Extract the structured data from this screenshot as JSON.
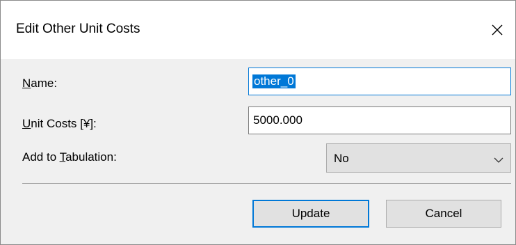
{
  "window": {
    "title": "Edit Other Unit Costs"
  },
  "form": {
    "name": {
      "label_mnemonic": "N",
      "label_rest": "ame:",
      "value": "other_0"
    },
    "unit_costs": {
      "label_mnemonic": "U",
      "label_rest": "nit Costs [¥]:",
      "value": "5000.000"
    },
    "tabulation": {
      "label_prefix": "Add to ",
      "label_mnemonic": "T",
      "label_rest": "abulation:",
      "selected": "No"
    }
  },
  "buttons": {
    "update_label": "Update",
    "cancel_label": "Cancel"
  },
  "icons": {
    "close": "close-icon",
    "dropdown": "chevron-down-icon"
  },
  "colors": {
    "accent": "#0078d7"
  }
}
